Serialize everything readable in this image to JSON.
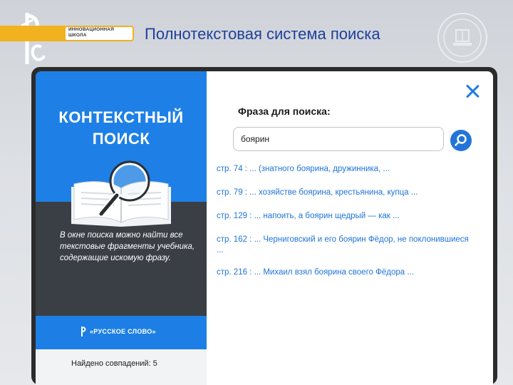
{
  "header": {
    "school_line1": "ИННОВАЦИОННАЯ",
    "school_line2": "ШКОЛА",
    "title": "Полнотекстовая система поиска"
  },
  "promo": {
    "title_line1": "КОНТЕКСТНЫЙ",
    "title_line2": "ПОИСК",
    "description": "В окне поиска можно найти все текстовые фрагменты учебника, содержащие искомую фразу.",
    "publisher": "«РУССКОЕ СЛОВО»"
  },
  "search": {
    "label": "Фраза для поиска:",
    "value": "боярин"
  },
  "results": [
    "стр. 74 : ... (знатного боярина, дружинника, ...",
    "стр. 79 : ... хозяйстве боярина, крестьянина, купца ...",
    "стр. 129 : ... напоить, а боярин щедрый — как ...",
    "стр. 162 : ... Черниговский и его боярин Фёдор, не поклонившиеся ...",
    "стр. 216 : ... Михаил взял боярина своего Фёдора ..."
  ],
  "status": {
    "matches": "Найдено совпадений: 5"
  },
  "colors": {
    "accent": "#1f74d6",
    "promo_blue": "#1e80e6",
    "promo_dark": "#3a3f45",
    "brand_yellow": "#f2b11f",
    "title_blue": "#1f3f9b"
  },
  "icons": [
    "brand-logo-icon",
    "seal-icon",
    "book-icon",
    "magnifier-icon",
    "close-icon",
    "search-icon",
    "publisher-logo-icon"
  ]
}
